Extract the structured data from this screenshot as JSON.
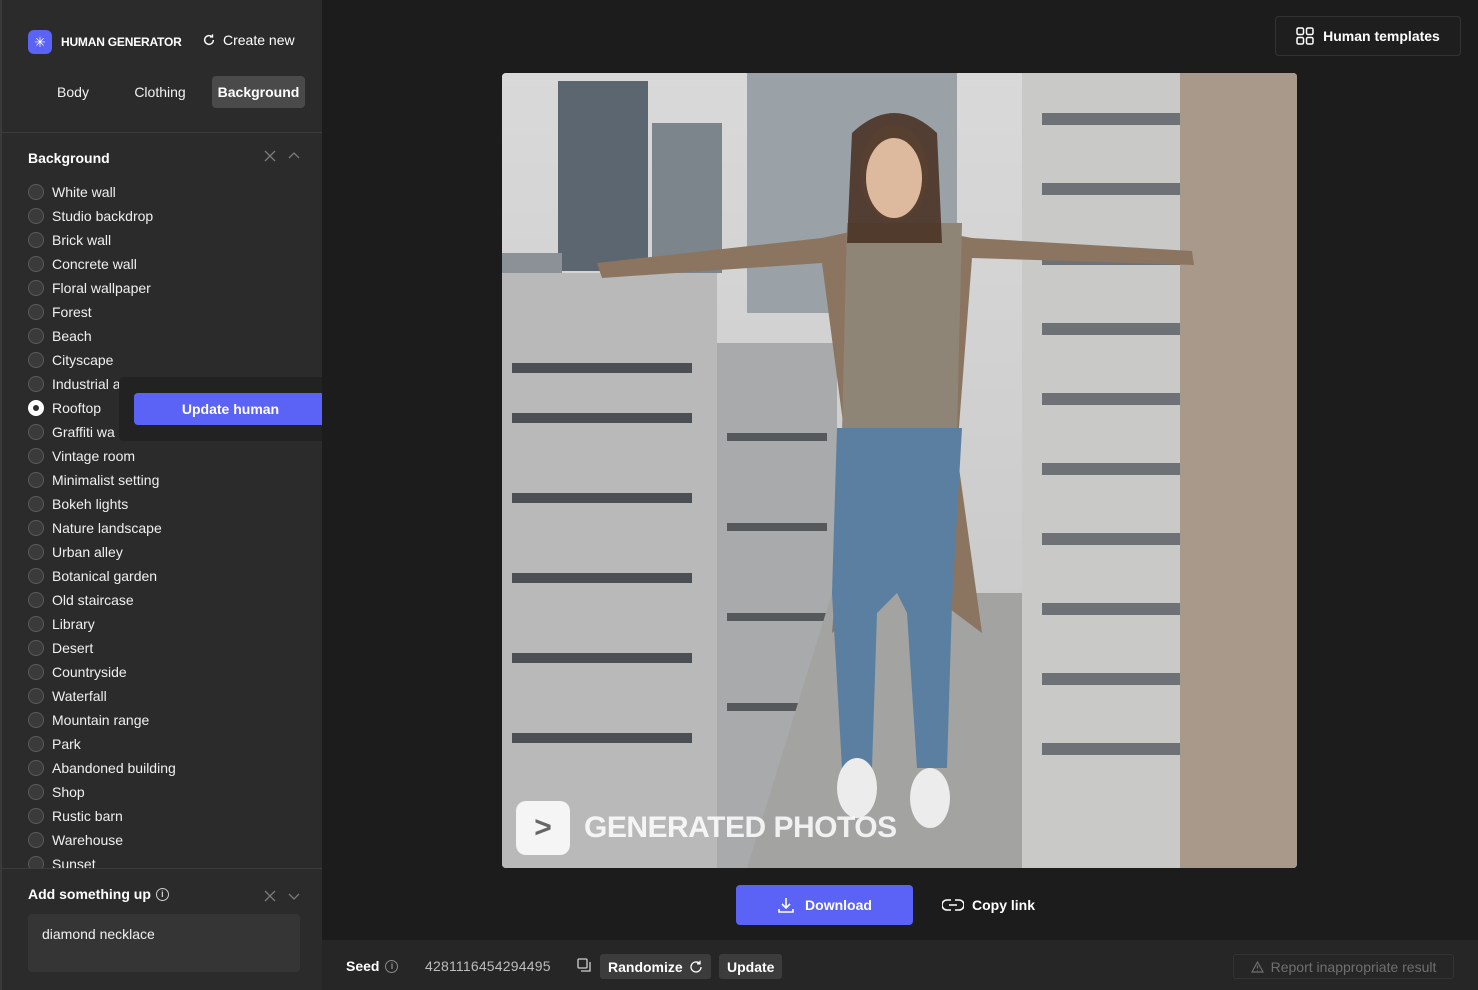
{
  "brand": {
    "name": "HUMAN GENERATOR",
    "logo_icon": "sparkle-icon"
  },
  "header": {
    "create_new": "Create new",
    "human_templates": "Human templates"
  },
  "tabs": [
    {
      "label": "Body",
      "active": false
    },
    {
      "label": "Clothing",
      "active": false
    },
    {
      "label": "Background",
      "active": true
    }
  ],
  "background_section": {
    "title": "Background",
    "options": [
      "White wall",
      "Studio backdrop",
      "Brick wall",
      "Concrete wall",
      "Floral wallpaper",
      "Forest",
      "Beach",
      "Cityscape",
      "Industrial a",
      "Rooftop",
      "Graffiti wa",
      "Vintage room",
      "Minimalist setting",
      "Bokeh lights",
      "Nature landscape",
      "Urban alley",
      "Botanical garden",
      "Old staircase",
      "Library",
      "Desert",
      "Countryside",
      "Waterfall",
      "Mountain range",
      "Park",
      "Abandoned building",
      "Shop",
      "Rustic barn",
      "Warehouse",
      "Sunset"
    ],
    "selected": "Rooftop"
  },
  "popover": {
    "update_human": "Update human"
  },
  "add_section": {
    "title": "Add something up",
    "value": "diamond necklace"
  },
  "image": {
    "watermark": "GENERATED PHOTOS",
    "watermark_logo": ">"
  },
  "actions": {
    "download": "Download",
    "copy_link": "Copy link"
  },
  "bottom": {
    "seed_label": "Seed",
    "seed_value": "4281116454294495",
    "randomize": "Randomize",
    "update": "Update",
    "report": "Report inappropriate result"
  },
  "colors": {
    "accent": "#5b63f6",
    "sidebar_bg": "#2b2b2b",
    "main_bg": "#1c1c1c"
  }
}
